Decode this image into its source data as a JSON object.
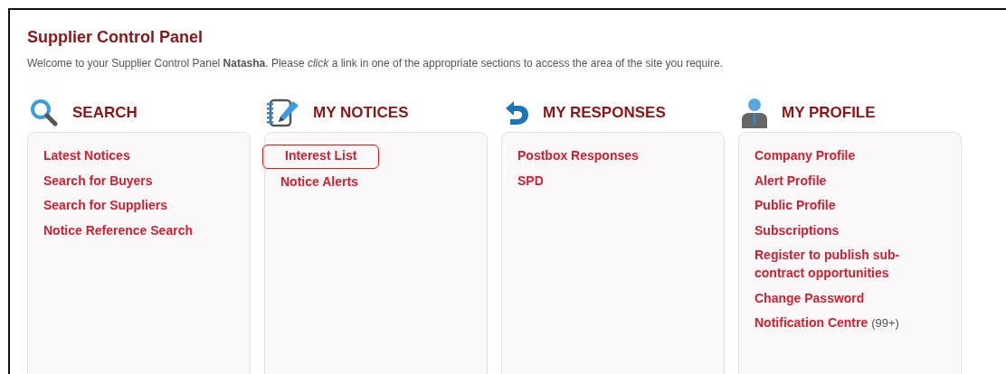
{
  "title": "Supplier Control Panel",
  "welcome": "Welcome to your Supplier Control Panel **Natasha**. Please *click* a link in one of the appropriate sections to access the area of the site you require.",
  "sections": [
    {
      "kind": "search",
      "heading": "SEARCH",
      "links": [
        {
          "label": "Latest Notices",
          "highlighted": false
        },
        {
          "label": "Search for Buyers",
          "highlighted": false
        },
        {
          "label": "Search for Suppliers",
          "highlighted": false
        },
        {
          "label": "Notice Reference Search",
          "highlighted": false
        }
      ]
    },
    {
      "kind": "notices",
      "heading": "MY NOTICES",
      "links": [
        {
          "label": "Interest List",
          "highlighted": true
        },
        {
          "label": "Notice Alerts",
          "highlighted": false
        }
      ]
    },
    {
      "kind": "responses",
      "heading": "MY RESPONSES",
      "links": [
        {
          "label": "Postbox Responses",
          "highlighted": false
        },
        {
          "label": "SPD",
          "highlighted": false
        }
      ]
    },
    {
      "kind": "profile",
      "heading": "MY PROFILE",
      "links": [
        {
          "label": "Company Profile",
          "highlighted": false
        },
        {
          "label": "Alert Profile",
          "highlighted": false
        },
        {
          "label": "Public Profile",
          "highlighted": false
        },
        {
          "label": "Subscriptions",
          "highlighted": false
        },
        {
          "label": "Register to publish sub-contract opportunities",
          "highlighted": false
        },
        {
          "label": "Change Password",
          "highlighted": false
        },
        {
          "label": "Notification Centre",
          "highlighted": false,
          "count": "(99+)"
        }
      ]
    }
  ]
}
